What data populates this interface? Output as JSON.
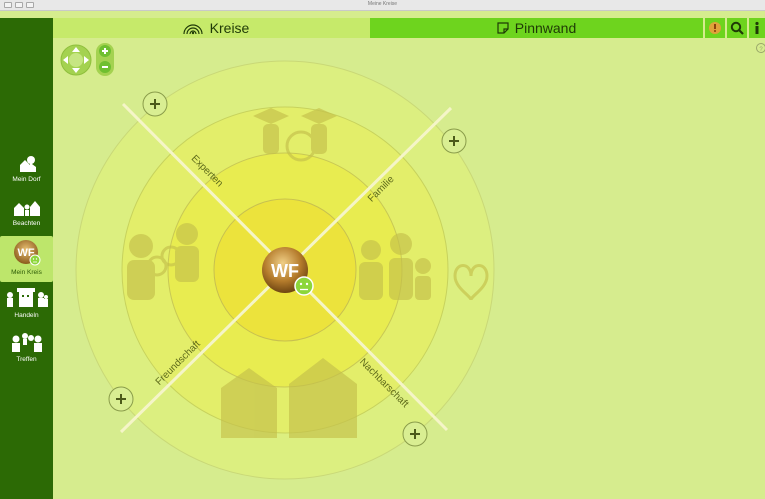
{
  "window": {
    "title": "Meine Kreise"
  },
  "tabs": {
    "kreise": "Kreise",
    "pinnwand": "Pinnwand"
  },
  "toolbar": {
    "alert_icon": "alert-badge-icon",
    "search_icon": "search-icon",
    "info_icon": "info-icon"
  },
  "sidebar": {
    "items": [
      {
        "label": "Mein Dorf",
        "icon": "village-icon"
      },
      {
        "label": "Beachten",
        "icon": "people-icon"
      },
      {
        "label": "Mein Kreis",
        "icon": "avatar-icon",
        "active": true
      },
      {
        "label": "Handeln",
        "icon": "handeln-icon"
      },
      {
        "label": "Treffen",
        "icon": "meet-icon"
      }
    ]
  },
  "circle": {
    "center_avatar": "WF",
    "quadrants": {
      "experten": "Experten",
      "familie": "Familie",
      "freundschaft": "Freundschaft",
      "nachbarschaft": "Nachbarschaft"
    }
  },
  "colors": {
    "background": "#d6ec8e",
    "sidebar": "#2c6a05",
    "tab_kreise": "#c6ea6a",
    "tab_pinnwand": "#6ed41e",
    "ring_outer": "#dcef80",
    "ring_inner": "#ece13a"
  }
}
